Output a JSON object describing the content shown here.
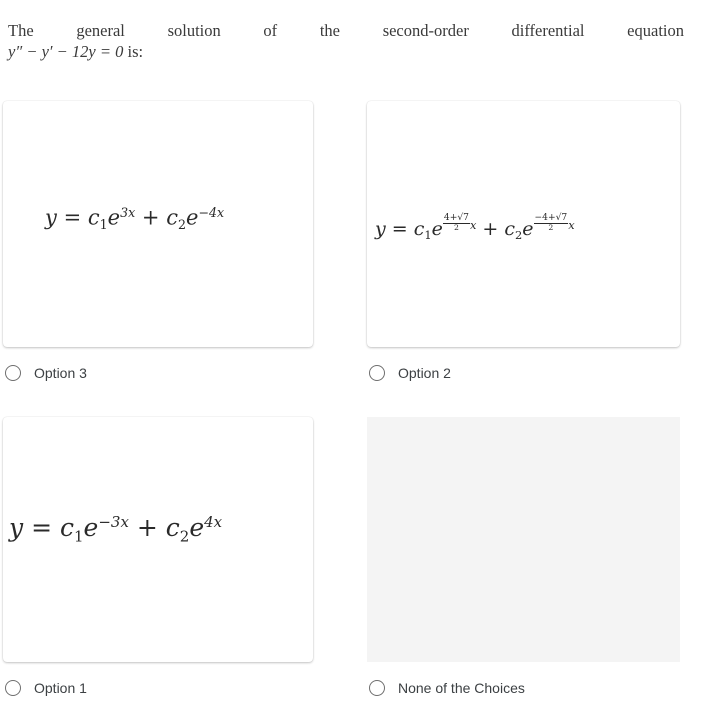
{
  "question": {
    "line1_words": [
      "The",
      "general",
      "solution",
      "of",
      "the",
      "second-order",
      "differential",
      "equation"
    ],
    "line2_equation": "y″ − y′ − 12y = 0",
    "line2_suffix": "is:"
  },
  "options": [
    {
      "id": "option-3",
      "label": "Option 3",
      "formula": {
        "lhs": "y",
        "eq": "=",
        "c1": "c",
        "c1_sub": "1",
        "e1": "e",
        "exp1": "3x",
        "plus": "+",
        "c2": "c",
        "c2_sub": "2",
        "e2": "e",
        "exp2": "−4x"
      },
      "selected": false
    },
    {
      "id": "option-2",
      "label": "Option 2",
      "formula": {
        "lhs": "y",
        "eq": "=",
        "c1": "c",
        "c1_sub": "1",
        "e1": "e",
        "exp1_num": "4+√7",
        "exp1_den": "2",
        "exp1_var": "x",
        "plus": "+",
        "c2": "c",
        "c2_sub": "2",
        "e2": "e",
        "exp2_num": "−4+√7",
        "exp2_den": "2",
        "exp2_var": "x"
      },
      "selected": false
    },
    {
      "id": "option-1",
      "label": "Option 1",
      "formula": {
        "lhs": "y",
        "eq": "=",
        "c1": "c",
        "c1_sub": "1",
        "e1": "e",
        "exp1": "−3x",
        "plus": "+",
        "c2": "c",
        "c2_sub": "2",
        "e2": "e",
        "exp2": "4x"
      },
      "selected": false
    },
    {
      "id": "option-none",
      "label": "None of the Choices",
      "formula": null,
      "selected": false
    }
  ],
  "colors": {
    "card_bg": "#ffffff",
    "empty_card_bg": "#f4f4f4",
    "radio_border": "#6f6f6f",
    "label_text": "#3c4043"
  }
}
